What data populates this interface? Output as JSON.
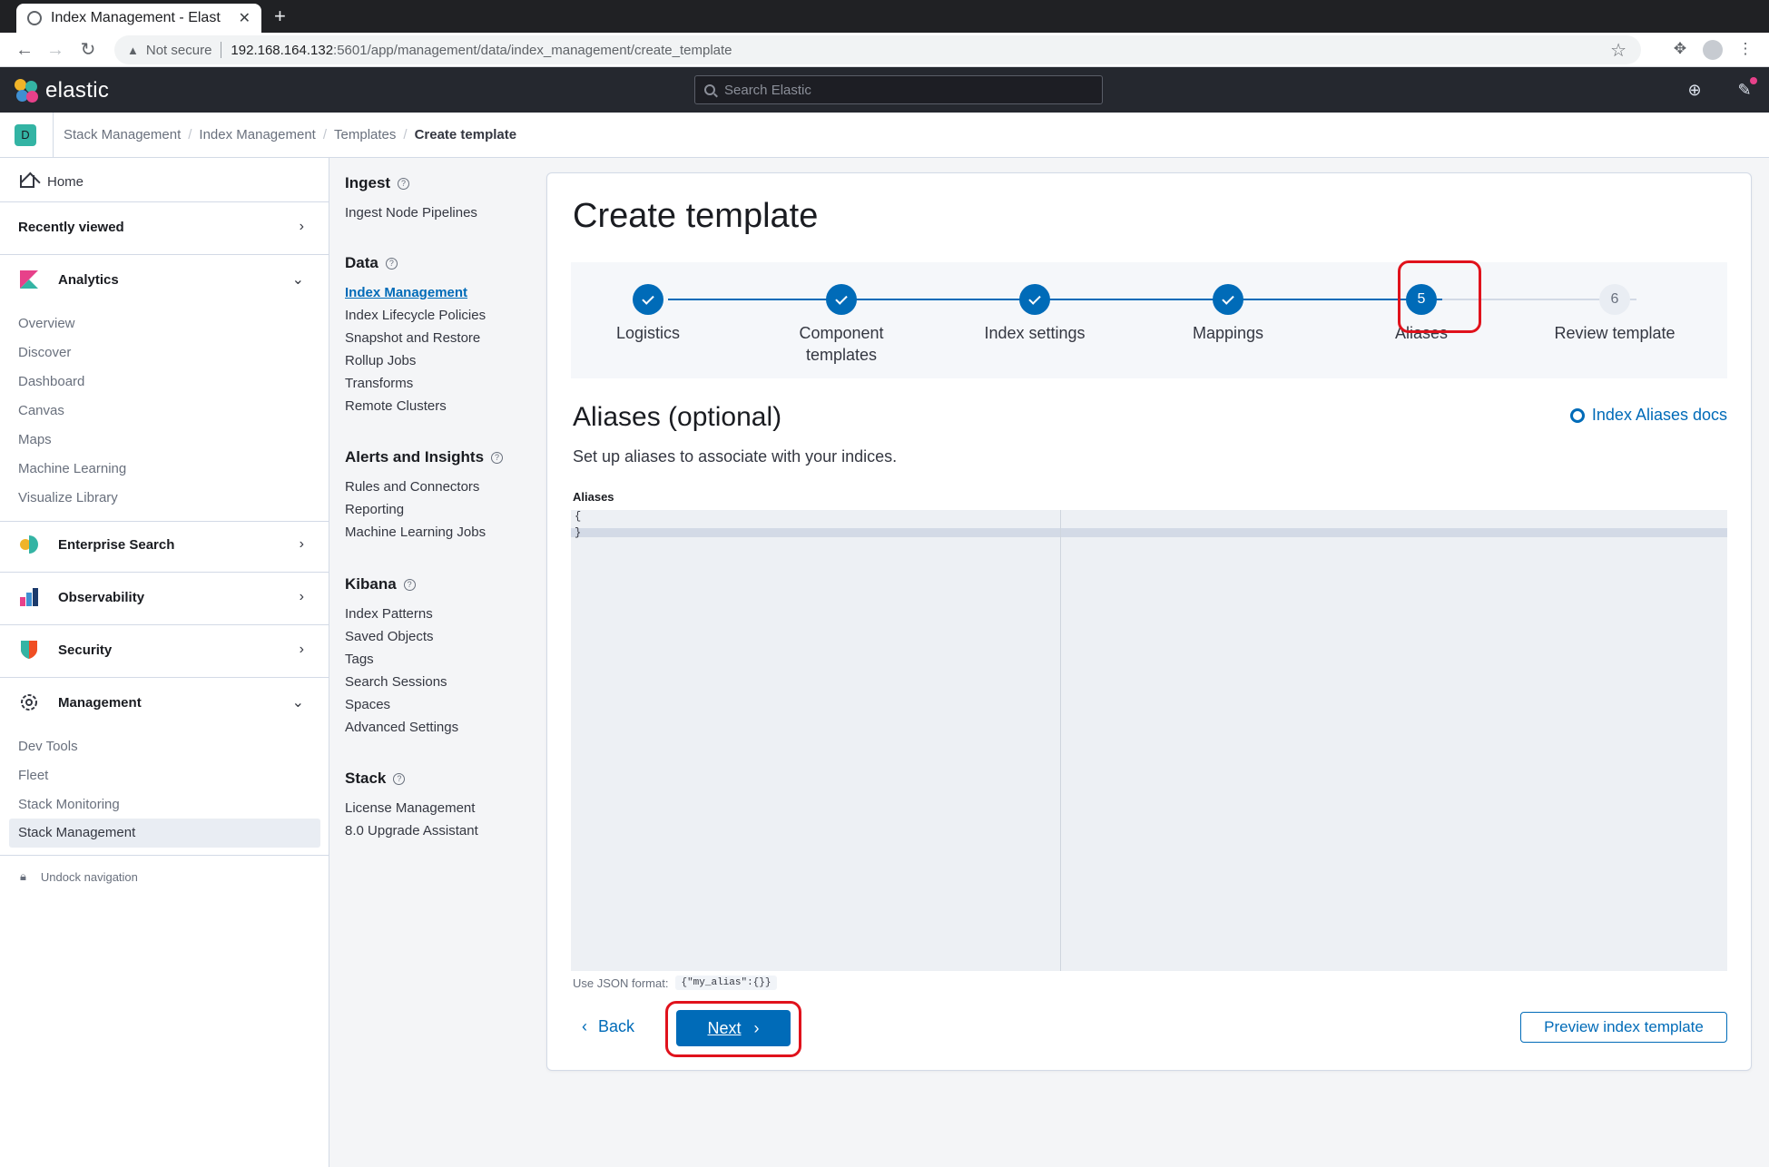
{
  "browser": {
    "tab_title": "Index Management - Elast",
    "not_secure": "Not secure",
    "url_host": "192.168.164.132",
    "url_path": ":5601/app/management/data/index_management/create_template"
  },
  "header": {
    "logo_text": "elastic",
    "search_placeholder": "Search Elastic"
  },
  "breadcrumbs": {
    "space_initial": "D",
    "items": [
      "Stack Management",
      "Index Management",
      "Templates",
      "Create template"
    ]
  },
  "leftnav": {
    "home": "Home",
    "recently_viewed": "Recently viewed",
    "analytics": {
      "label": "Analytics",
      "items": [
        "Overview",
        "Discover",
        "Dashboard",
        "Canvas",
        "Maps",
        "Machine Learning",
        "Visualize Library"
      ]
    },
    "enterprise_search": "Enterprise Search",
    "observability": "Observability",
    "security": "Security",
    "management": {
      "label": "Management",
      "items": [
        "Dev Tools",
        "Fleet",
        "Stack Monitoring",
        "Stack Management"
      ]
    },
    "undock": "Undock navigation"
  },
  "mgmt_nav": {
    "ingest": {
      "title": "Ingest",
      "items": [
        "Ingest Node Pipelines"
      ]
    },
    "data": {
      "title": "Data",
      "items": [
        "Index Management",
        "Index Lifecycle Policies",
        "Snapshot and Restore",
        "Rollup Jobs",
        "Transforms",
        "Remote Clusters"
      ]
    },
    "alerts": {
      "title": "Alerts and Insights",
      "items": [
        "Rules and Connectors",
        "Reporting",
        "Machine Learning Jobs"
      ]
    },
    "kibana": {
      "title": "Kibana",
      "items": [
        "Index Patterns",
        "Saved Objects",
        "Tags",
        "Search Sessions",
        "Spaces",
        "Advanced Settings"
      ]
    },
    "stack": {
      "title": "Stack",
      "items": [
        "License Management",
        "8.0 Upgrade Assistant"
      ]
    }
  },
  "main": {
    "title": "Create template",
    "steps": [
      {
        "label": "Logistics",
        "status": "complete"
      },
      {
        "label": "Component templates",
        "status": "complete"
      },
      {
        "label": "Index settings",
        "status": "complete"
      },
      {
        "label": "Mappings",
        "status": "complete"
      },
      {
        "label": "Aliases",
        "status": "current",
        "number": "5"
      },
      {
        "label": "Review template",
        "status": "incomplete",
        "number": "6"
      }
    ],
    "section_title": "Aliases (optional)",
    "section_desc": "Set up aliases to associate with your indices.",
    "docs_link": "Index Aliases docs",
    "field_label": "Aliases",
    "editor_lines": [
      "{",
      "}"
    ],
    "help_text": "Use JSON format:",
    "help_code": "{\"my_alias\":{}}",
    "back_label": "Back",
    "next_label": "Next",
    "preview_label": "Preview index template"
  },
  "colors": {
    "accent": "#006bb8",
    "highlight": "#e0121c",
    "header_bg": "#25282f"
  }
}
